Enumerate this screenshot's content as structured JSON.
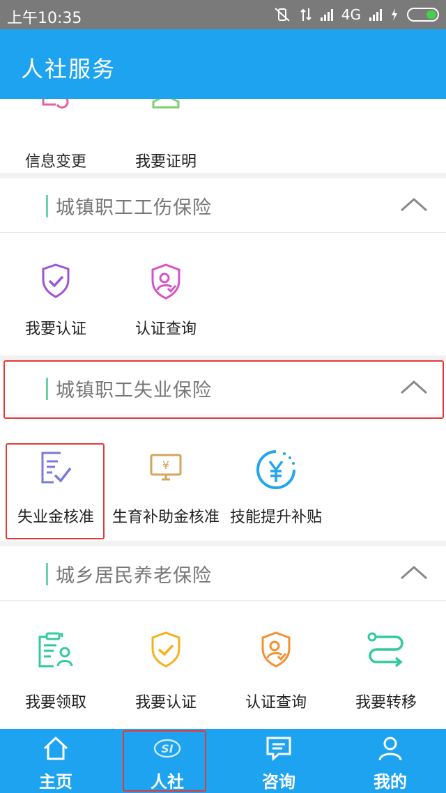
{
  "status": {
    "time": "上午10:35",
    "network": "4G"
  },
  "header": {
    "title": "人社服务"
  },
  "top_row": [
    {
      "label": "信息变更",
      "icon": "info-change-icon"
    },
    {
      "label": "我要证明",
      "icon": "stamp-icon"
    }
  ],
  "sections": [
    {
      "title": "城镇职工工伤保险",
      "items": [
        {
          "label": "我要认证",
          "icon": "shield-check-icon"
        },
        {
          "label": "认证查询",
          "icon": "shield-user-icon"
        }
      ]
    },
    {
      "title": "城镇职工失业保险",
      "items": [
        {
          "label": "失业金核准",
          "icon": "document-check-icon"
        },
        {
          "label": "生育补助金核准",
          "icon": "yen-monitor-icon"
        },
        {
          "label": "技能提升补贴",
          "icon": "yen-circle-icon"
        }
      ]
    },
    {
      "title": "城乡居民养老保险",
      "items": [
        {
          "label": "我要领取",
          "icon": "clipboard-user-icon"
        },
        {
          "label": "我要认证",
          "icon": "shield-check-icon"
        },
        {
          "label": "认证查询",
          "icon": "shield-user-icon"
        },
        {
          "label": "我要转移",
          "icon": "transfer-route-icon"
        }
      ]
    }
  ],
  "nav": [
    {
      "label": "主页",
      "icon": "home-icon"
    },
    {
      "label": "人社",
      "icon": "si-logo-icon"
    },
    {
      "label": "咨询",
      "icon": "message-icon"
    },
    {
      "label": "我的",
      "icon": "user-icon"
    }
  ],
  "colors": {
    "primary": "#1ea3f0",
    "highlight_box": "#e23a3a",
    "accent_bar": "#6cd2a8"
  }
}
